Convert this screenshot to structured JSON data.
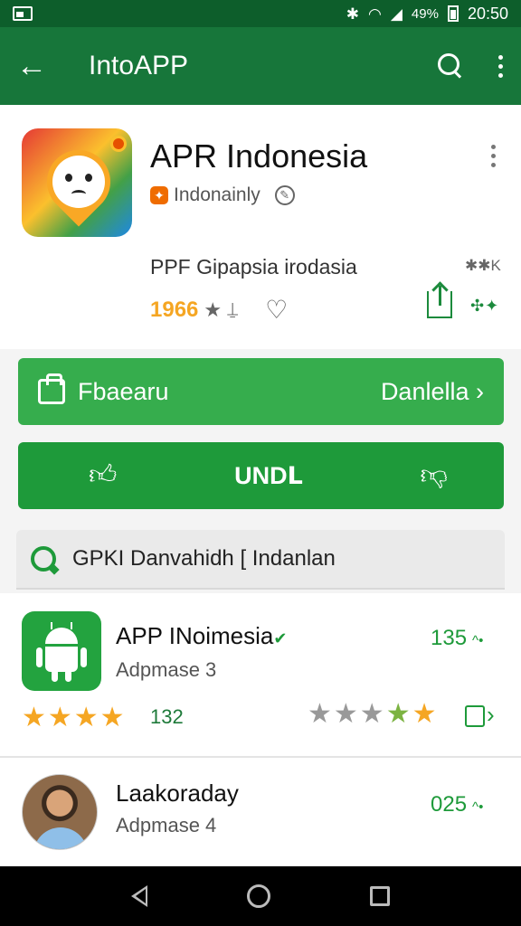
{
  "status_bar": {
    "icons": [
      "screenshot-icon",
      "bluetooth-icon",
      "wifi-icon",
      "signal-icon",
      "battery-icon"
    ],
    "battery_text": "49%",
    "time": "20:50"
  },
  "app_bar": {
    "back_icon": "arrow-back-icon",
    "title": "IntoAPP",
    "actions": [
      "search-icon",
      "more-vert-icon"
    ]
  },
  "app": {
    "name": "APR Indonesia",
    "developer": "Indonainly",
    "tagline": "PPF Gipapsia irodasia",
    "tagline_extra": "✱✱K",
    "rating_count": "1966",
    "accent_color": "#f5a623"
  },
  "buttons": {
    "primary_label": "Fbaearu",
    "primary_right": "Danlella ›",
    "primary_color": "#36ad4d",
    "secondary_label": "UNDⅬ",
    "secondary_color": "#1e9a3a"
  },
  "section": {
    "label": "GPKI Danvahidh [ Indanlan"
  },
  "list": [
    {
      "title": "APP INoimesia",
      "subtitle": "Adpmase 3",
      "count": "135",
      "rating_count": "132",
      "icon": "android-icon"
    },
    {
      "title": "Laakoraday",
      "subtitle": "Adpmase 4",
      "count": "025",
      "icon": "avatar"
    }
  ],
  "nav_bar": {
    "icons": [
      "nav-back-icon",
      "nav-home-icon",
      "nav-recent-icon"
    ]
  }
}
